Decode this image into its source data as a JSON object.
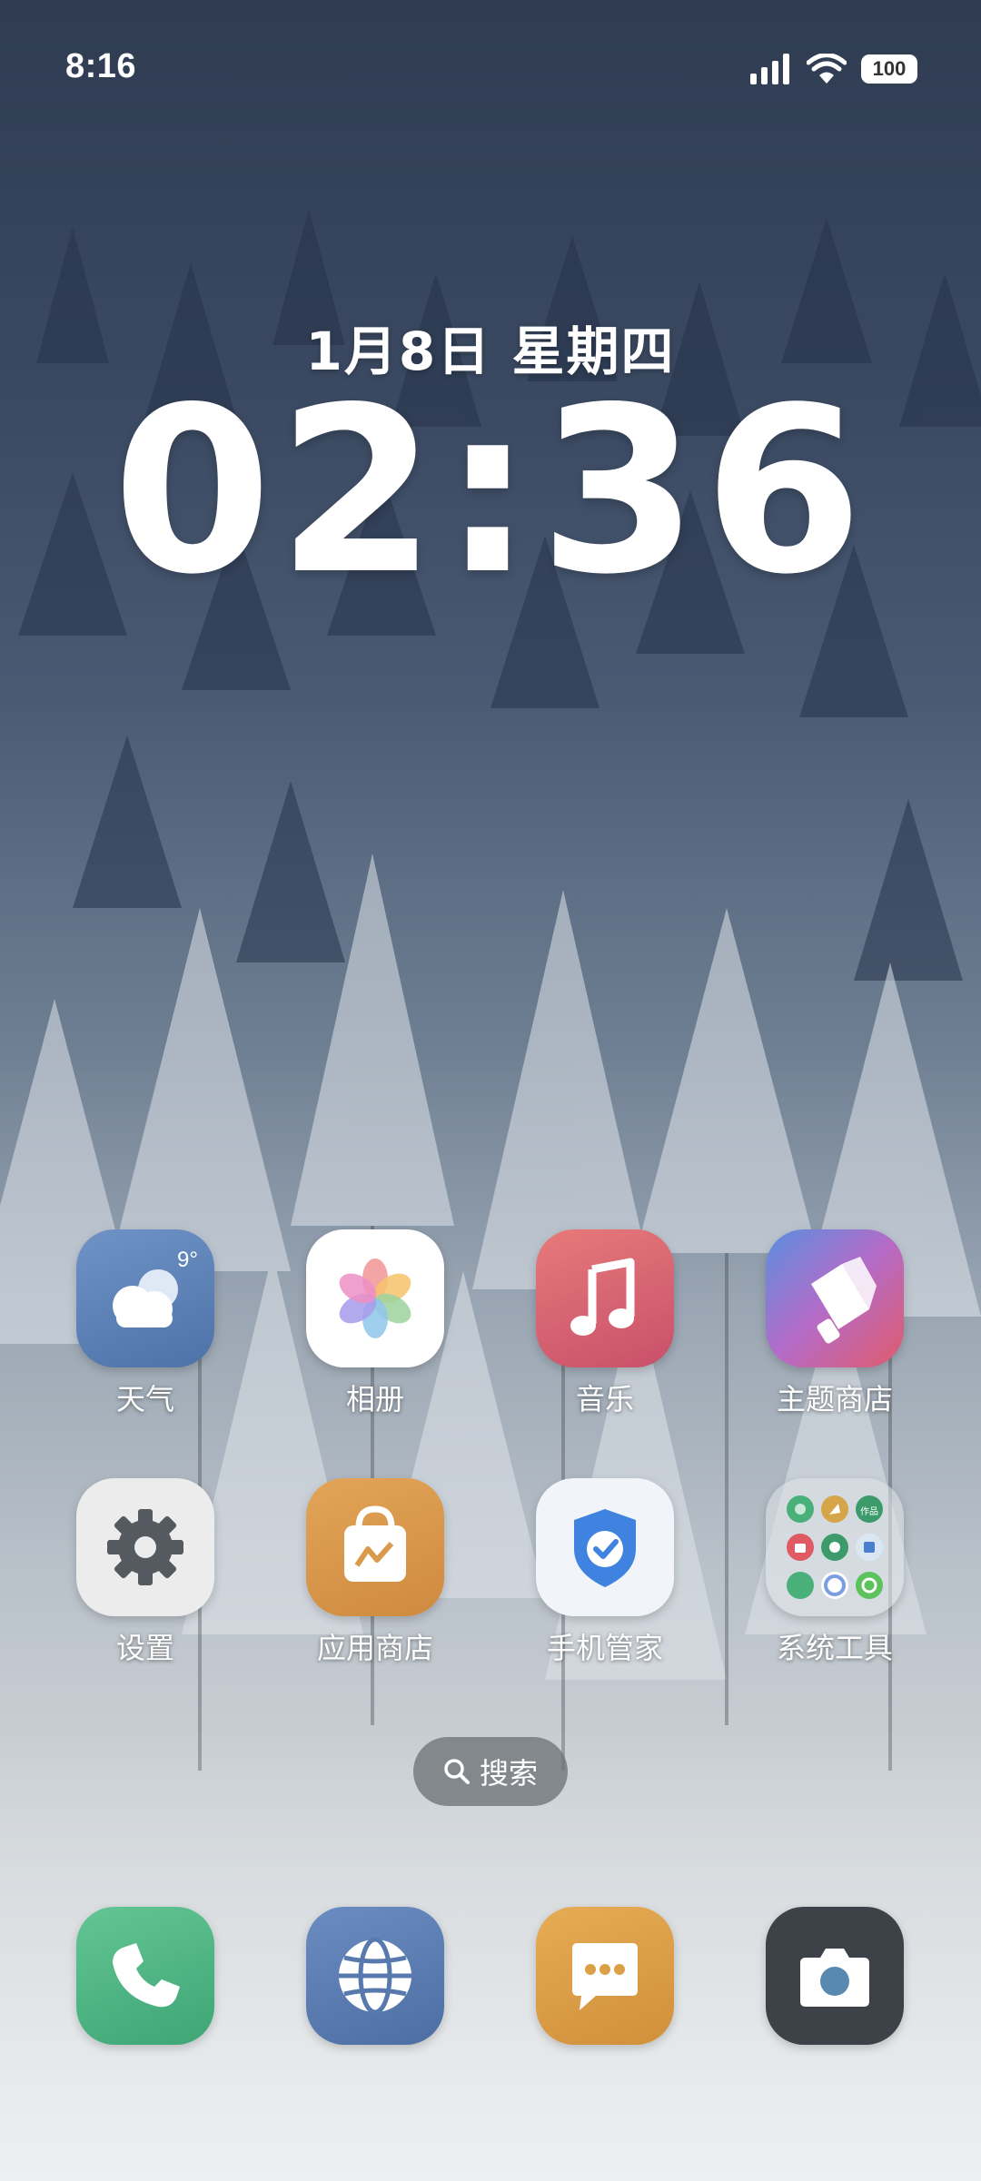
{
  "status_bar": {
    "time": "8:16",
    "battery": "100"
  },
  "clock_widget": {
    "date": "1月8日 星期四",
    "time": "02:36"
  },
  "apps": {
    "weather": {
      "label": "天气",
      "temp": "9°",
      "icon": "weather-cloud-icon",
      "color": "#5a7fb3"
    },
    "photos": {
      "label": "相册",
      "icon": "photos-flower-icon",
      "color": "#ffffff"
    },
    "music": {
      "label": "音乐",
      "icon": "music-note-icon",
      "color": "#d9596b"
    },
    "themes": {
      "label": "主题商店",
      "icon": "theme-brush-icon",
      "color": "#c4517b"
    },
    "settings": {
      "label": "设置",
      "icon": "gear-icon",
      "color": "#e6e6e6"
    },
    "app_store": {
      "label": "应用商店",
      "icon": "shopping-bag-icon",
      "color": "#d99a4c"
    },
    "phone_manager": {
      "label": "手机管家",
      "icon": "shield-check-icon",
      "color": "#eef2f8"
    },
    "system_tools": {
      "label": "系统工具",
      "mini_label": "作品",
      "icon": "folder-icon"
    }
  },
  "search": {
    "label": "搜索",
    "icon": "search-icon"
  },
  "dock": {
    "phone": {
      "icon": "phone-icon",
      "color": "#52b788"
    },
    "browser": {
      "icon": "globe-icon",
      "color": "#5779ad"
    },
    "messages": {
      "icon": "message-icon",
      "color": "#d9a046"
    },
    "camera": {
      "icon": "camera-icon",
      "color": "#3d4248"
    }
  }
}
